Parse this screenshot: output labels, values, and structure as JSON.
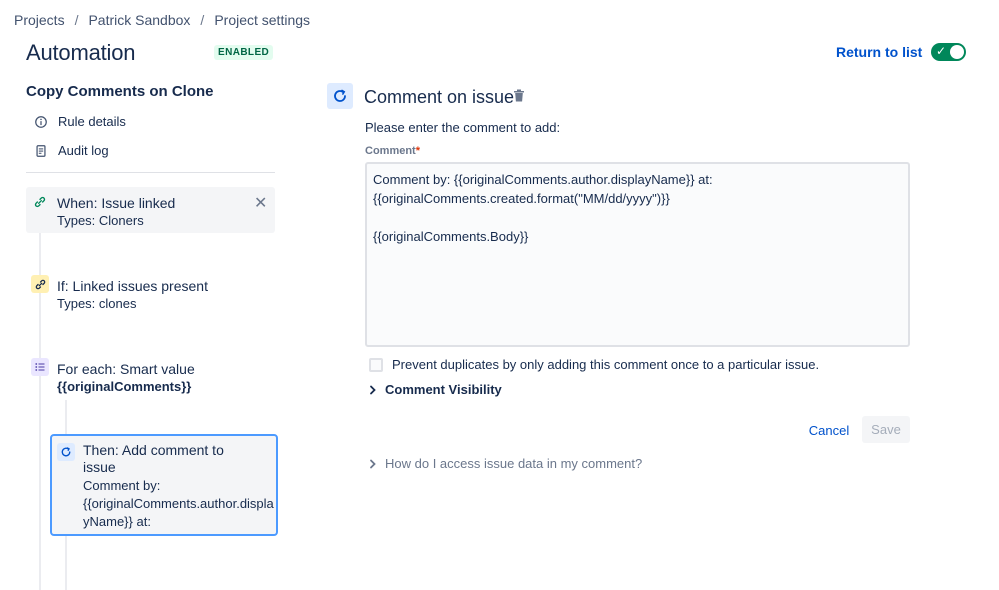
{
  "breadcrumb": [
    "Projects",
    "Patrick Sandbox",
    "Project settings"
  ],
  "breadcrumb_sep": "/",
  "header": {
    "title": "Automation",
    "status_badge": "ENABLED",
    "return_link": "Return to list",
    "toggle_on": true,
    "accent_color": "#00875a"
  },
  "sidebar": {
    "rule_name": "Copy Comments on Clone",
    "links": [
      {
        "label": "Rule details",
        "icon": "info-icon"
      },
      {
        "label": "Audit log",
        "icon": "document-icon"
      }
    ],
    "steps": {
      "trigger": {
        "title": "When: Issue linked",
        "sub": "Types: Cloners",
        "icon": "link-icon"
      },
      "condition": {
        "title": "If: Linked issues present",
        "sub": "Types: clones",
        "icon": "link-icon"
      },
      "branch": {
        "title": "For each: Smart value",
        "sub": "{{originalComments}}",
        "icon": "list-icon"
      },
      "action": {
        "title_line1": "Then: Add comment to",
        "title_line2": "issue",
        "sub_line1": "Comment by:",
        "sub_line2": "{{originalComments.author.displa",
        "sub_line3": "yName}} at:",
        "icon": "comment-refresh-icon"
      }
    }
  },
  "main": {
    "title": "Comment on issue",
    "prompt": "Please enter the comment to add:",
    "field_label": "Comment",
    "required_mark": "*",
    "comment_value": "Comment by: {{originalComments.author.displayName}} at:\n{{originalComments.created.format(\"MM/dd/yyyy\")}}\n\n{{originalComments.Body}}",
    "prevent_duplicates_label": "Prevent duplicates by only adding this comment once to a particular issue.",
    "prevent_duplicates_checked": false,
    "visibility_label": "Comment Visibility",
    "cancel_label": "Cancel",
    "save_label": "Save",
    "help_label": "How do I access issue data in my comment?"
  }
}
